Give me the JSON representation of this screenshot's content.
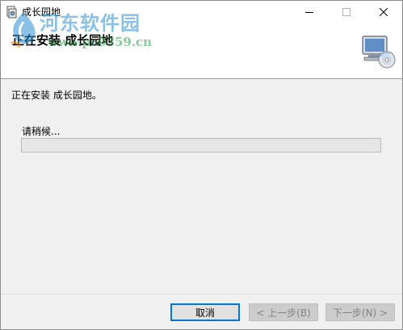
{
  "window": {
    "title": "成长园地",
    "minimize_glyph": "—",
    "maximize_glyph": "☐",
    "close_glyph": "✕"
  },
  "watermark": {
    "title": "河东软件园",
    "url": "www.pc0359.cn"
  },
  "banner": {
    "title": "正在安装 成长园地",
    "icon": "computer-cd-icon"
  },
  "main": {
    "status_text": "正在安装 成长园地。",
    "wait_label": "请稍候...",
    "progress": 0
  },
  "footer": {
    "cancel_label": "取消",
    "back_label": "< 上一步(B)",
    "next_label": "下一步(N) >"
  },
  "colors": {
    "accent": "#0078d7",
    "progress_fill": "#06b025",
    "watermark_blue": "#2a8fd6",
    "watermark_green": "#2aa04a"
  }
}
